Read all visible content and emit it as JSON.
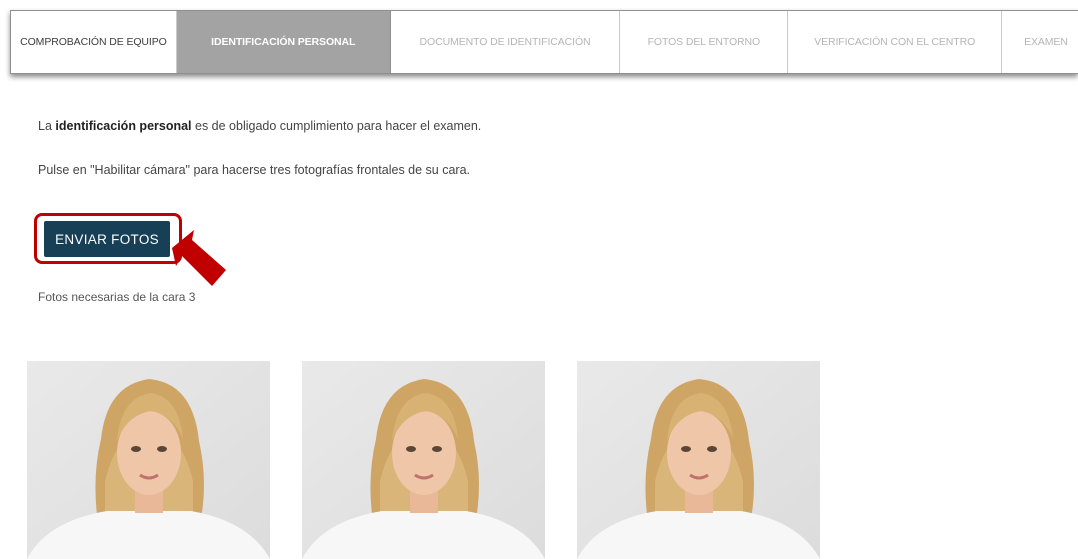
{
  "steps": [
    {
      "label": "COMPROBACIÓN DE EQUIPO",
      "state": "done"
    },
    {
      "label": "IDENTIFICACIÓN PERSONAL",
      "state": "active"
    },
    {
      "label": "DOCUMENTO DE IDENTIFICACIÓN",
      "state": "pending"
    },
    {
      "label": "FOTOS DEL ENTORNO",
      "state": "pending"
    },
    {
      "label": "VERIFICACIÓN CON EL CENTRO",
      "state": "pending"
    },
    {
      "label": "EXAMEN",
      "state": "pending"
    }
  ],
  "intro": {
    "prefix": "La ",
    "bold": "identificación personal",
    "suffix": " es de obligado cumplimiento para hacer el examen."
  },
  "instruction": "Pulse en \"Habilitar cámara\" para hacerse tres fotografías frontales de su cara.",
  "send_button_label": "ENVIAR FOTOS",
  "photos_needed": "Fotos necesarias de la cara 3",
  "photos": [
    {
      "icon": "face-photo"
    },
    {
      "icon": "face-photo"
    },
    {
      "icon": "face-photo"
    }
  ],
  "colors": {
    "active_step_bg": "#a3a3a3",
    "button_bg": "#173f55",
    "highlight": "#c00000"
  }
}
